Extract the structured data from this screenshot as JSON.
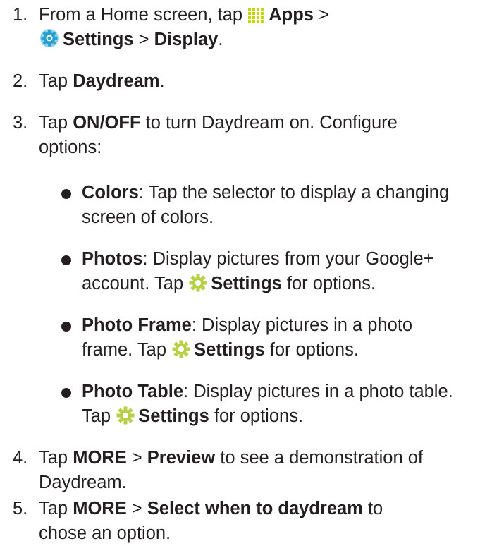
{
  "steps": [
    {
      "number": "1.",
      "line1": {
        "pre": "From a Home screen, tap ",
        "apps_label": "Apps",
        "post": " >"
      },
      "line2": {
        "settings_label": "Settings",
        "sep": " > ",
        "display_label": "Display",
        "end": "."
      }
    },
    {
      "number": "2.",
      "pre": "Tap ",
      "bold": "Daydream",
      "end": "."
    },
    {
      "number": "3.",
      "line1": {
        "pre": "Tap ",
        "bold": "ON/OFF",
        "post": " to turn Daydream on. Configure"
      },
      "line2": "options:"
    },
    {
      "number": "4.",
      "line1": {
        "pre": "Tap ",
        "more": "MORE",
        "sep": " > ",
        "bold": "Preview",
        "post": " to see a demonstration of"
      },
      "line2": "Daydream."
    },
    {
      "number": "5.",
      "line1": {
        "pre": "Tap ",
        "more": "MORE",
        "sep": " > ",
        "bold": "Select when to daydream",
        "post": " to"
      },
      "line2": "chose an option."
    }
  ],
  "options": [
    {
      "term": "Colors",
      "line1": ": Tap the selector to display a changing",
      "line2": "screen of colors."
    },
    {
      "term": "Photos",
      "line1": ": Display pictures from your Google+",
      "line2_pre": "account. Tap ",
      "settings_label": "Settings",
      "line2_post": " for options."
    },
    {
      "term": "Photo Frame",
      "line1": ": Display pictures in a photo",
      "line2_pre": "frame. Tap ",
      "settings_label": "Settings",
      "line2_post": " for options."
    },
    {
      "term": "Photo Table",
      "line1": ": Display pictures in a photo table.",
      "line2_pre": "Tap ",
      "settings_label": "Settings",
      "line2_post": " for options."
    }
  ],
  "icons": {
    "apps": "apps-grid-icon",
    "settings_app": "settings-app-icon",
    "settings_gear": "gear-icon"
  },
  "colors": {
    "text": "#231f20",
    "apps_icon": "#c4d600",
    "settings_app_outer": "#8fd2e8",
    "settings_app_inner": "#2a9fd0",
    "gear": "#b6d04a"
  }
}
